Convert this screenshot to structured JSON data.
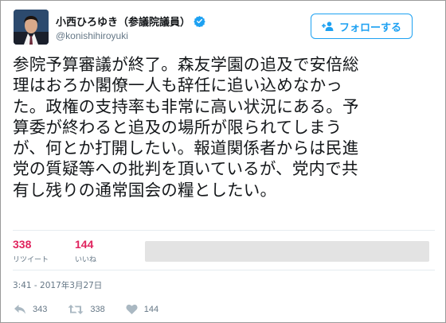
{
  "user": {
    "display_name": "小西ひろゆき（参議院議員）",
    "handle": "@konishihiroyuki",
    "avatar_icon": "profile-photo",
    "verified_icon": "verified-badge-icon"
  },
  "follow_button": {
    "label": "フォローする",
    "icon": "add-user-icon",
    "color": "#1da1f2"
  },
  "tweet": {
    "text": "参院予算審議が終了。森友学園の追及で安倍総\n理はおろか閣僚一人も辞任に追い込めなかっ\nた。政権の支持率も非常に高い状況にある。予\n算委が終わると追及の場所が限られてしまう\nが、何とか打開したい。報道関係者からは民進\n党の質疑等への批判を頂いているが、党内で共\n有し残りの通常国会の糧としたい。"
  },
  "stats": {
    "retweets": {
      "value": "338",
      "label": "リツイート"
    },
    "likes": {
      "value": "144",
      "label": "いいね"
    },
    "accent_color": "#e0245e"
  },
  "timestamp": "3:41 - 2017年3月27日",
  "actions": {
    "reply": {
      "icon": "reply-icon",
      "count": "343"
    },
    "retweet": {
      "icon": "retweet-icon",
      "count": "338"
    },
    "like": {
      "icon": "heart-icon",
      "count": "144"
    }
  }
}
